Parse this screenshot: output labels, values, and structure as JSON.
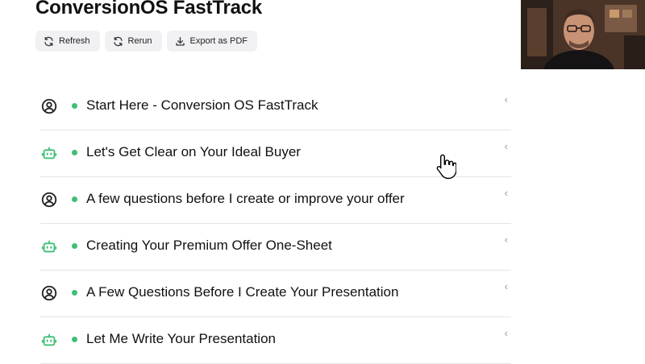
{
  "page": {
    "title": "ConversionOS FastTrack"
  },
  "toolbar": {
    "refresh_label": "Refresh",
    "rerun_label": "Rerun",
    "export_label": "Export as PDF"
  },
  "steps": [
    {
      "label": "Start Here - Conversion OS FastTrack",
      "icon": "user-circle-icon"
    },
    {
      "label": "Let's Get Clear on Your Ideal Buyer",
      "icon": "robot-icon"
    },
    {
      "label": "A few questions before I create or improve your offer",
      "icon": "user-circle-icon"
    },
    {
      "label": "Creating Your Premium Offer One-Sheet",
      "icon": "robot-icon"
    },
    {
      "label": "A Few Questions Before I Create Your Presentation",
      "icon": "user-circle-icon"
    },
    {
      "label": "Let Me Write Your Presentation",
      "icon": "robot-icon"
    }
  ],
  "colors": {
    "status_dot": "#3dbf75",
    "robot_icon": "#3dbf75",
    "user_icon": "#222222"
  }
}
